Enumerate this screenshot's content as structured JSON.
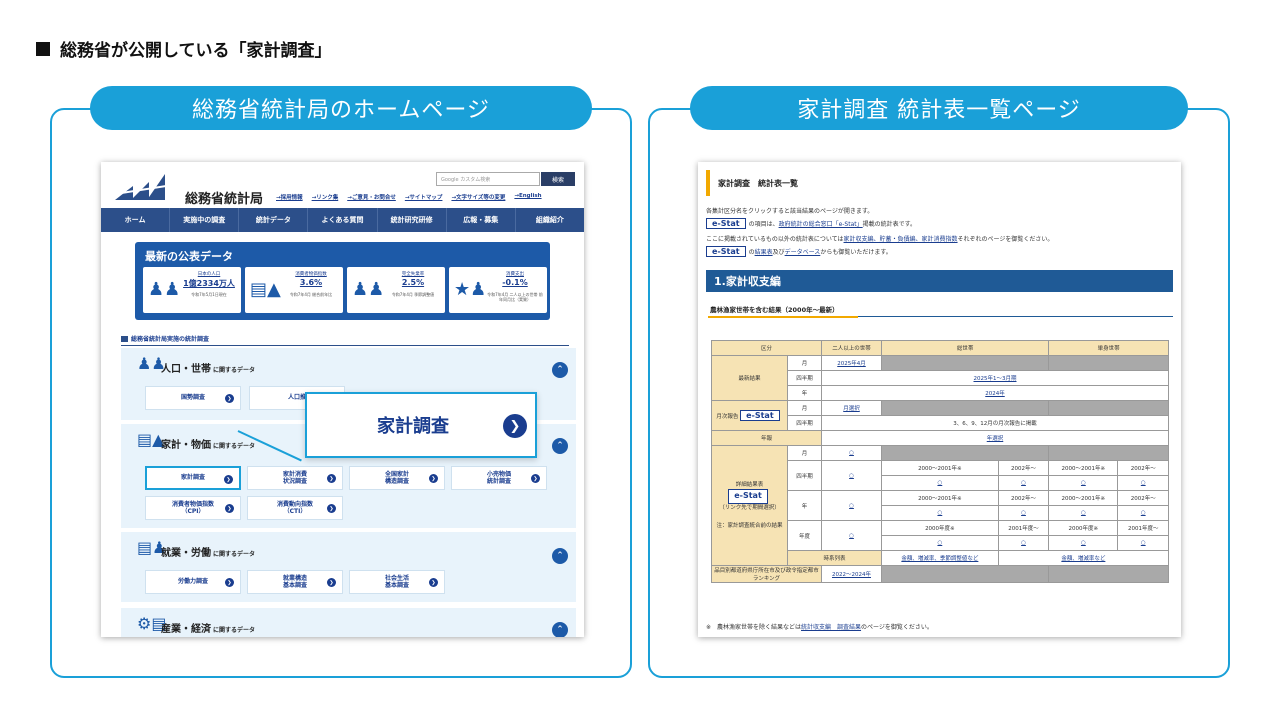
{
  "page_title": "総務省が公開している「家計調査」",
  "left_panel": {
    "pill": "総務省統計局のホームページ",
    "site_name": "総務省統計局",
    "search_placeholder": "Google カスタム検索",
    "search_button": "検索",
    "util_links": [
      "→採用情報",
      "→リンク集",
      "→ご意見・お問合せ",
      "→サイトマップ",
      "→文字サイズ等の変更",
      "→English"
    ],
    "gnav": [
      "ホーム",
      "実施中の調査",
      "統計データ",
      "よくある質問",
      "統計研究研修",
      "広報・募集",
      "組織紹介"
    ],
    "banner_title": "最新の公表データ",
    "stats": [
      {
        "label": "日本の人口",
        "value": "1億2334万人",
        "note": "令和7年5月1日現在",
        "icon": "people-icon"
      },
      {
        "label": "消費者物価指数",
        "value": "3.6%",
        "note": "令和7年4月 総合前年比",
        "icon": "price-chart-icon"
      },
      {
        "label": "完全失業率",
        "value": "2.5%",
        "note": "令和7年4月 季節調整値",
        "icon": "workers-icon"
      },
      {
        "label": "消費支出",
        "value": "-0.1%",
        "note": "令和7年4月 二人以上の世帯 前年同月比（実質）",
        "icon": "spending-icon"
      }
    ],
    "section_strip": "総務省統計局実施の統計調査",
    "categories": [
      {
        "title": "人口・世帯",
        "suffix": "に関するデータ",
        "buttons": [
          "国勢調査",
          "人口推"
        ]
      },
      {
        "title": "家計・物価",
        "suffix": "に関するデータ",
        "buttons": [
          "家計調査",
          "家計消費\n状況調査",
          "全国家計\n構造調査",
          "小売物価\n統計調査",
          "消費者物価指数\n（CPI）",
          "消費動向指数\n（CTI）"
        ]
      },
      {
        "title": "就業・労働",
        "suffix": "に関するデータ",
        "buttons": [
          "労働力調査",
          "就業構造\n基本調査",
          "社会生活\n基本調査"
        ]
      },
      {
        "title": "産業・経済",
        "suffix": "に関するデータ",
        "buttons": []
      }
    ],
    "callout": "家計調査"
  },
  "right_panel": {
    "pill": "家計調査 統計表一覧ページ",
    "title": "家計調査　統計表一覧",
    "intro1": "各集計区分名をクリックすると該当結果のページが開きます。",
    "estat_label": "e-Stat",
    "intro2_pre": "の項目は、",
    "intro2_link": "政府統計の総合窓口「e-Stat」",
    "intro2_post": "掲載の統計表です。",
    "intro3": "ここに掲載されているもの以外の統計表については",
    "intro3_links": "家計収支編、貯蓄・負債編、家計消費指数",
    "intro3_post": "それぞれのページを御覧ください。",
    "intro4_pre": "の",
    "intro4_link1": "結果表",
    "intro4_mid": "及び",
    "intro4_link2": "データベース",
    "intro4_post": "からも御覧いただけます。",
    "section_bar": "1.家計収支編",
    "subheading": "農林漁家世帯を含む結果（2000年～最新）",
    "table": {
      "headers": [
        "区分",
        "",
        "二人以上の世帯",
        "総世帯",
        "単身世帯"
      ],
      "latest_label": "最新結果",
      "month": "月",
      "quarter": "四半期",
      "year": "年",
      "yeardo": "年度",
      "latest_month": "2025年4月",
      "latest_quarter": "2025年1～3月期",
      "latest_year": "2024年",
      "monthly_label": "月次報告",
      "monthly_link": "月選択",
      "monthly_quarter_note": "3、6、9、12月の月次報告に掲載",
      "annual_label": "年報",
      "annual_link": "年選択",
      "detail_label": "詳細結果表",
      "detail_note": "（リンク先で期間選択）",
      "detail_note2": "注：家計調査統合前の結果",
      "circle": "○",
      "p1": "2000～2001年※",
      "p2": "2002年～",
      "p3": "2000年度※",
      "p4": "2001年度～",
      "timeseries_label": "時系列表",
      "timeseries_link1": "金額、増減率、季節調整値など",
      "timeseries_link2": "金額、増減率など",
      "ranking_label": "品目別都道府県庁所在市及び政令指定都市ランキング",
      "ranking_link": "2022～2024年"
    },
    "footnote_pre": "※　農林漁家世帯を除く結果などは",
    "footnote_link": "統計収支編　調査結果",
    "footnote_post": "のページを御覧ください。"
  }
}
